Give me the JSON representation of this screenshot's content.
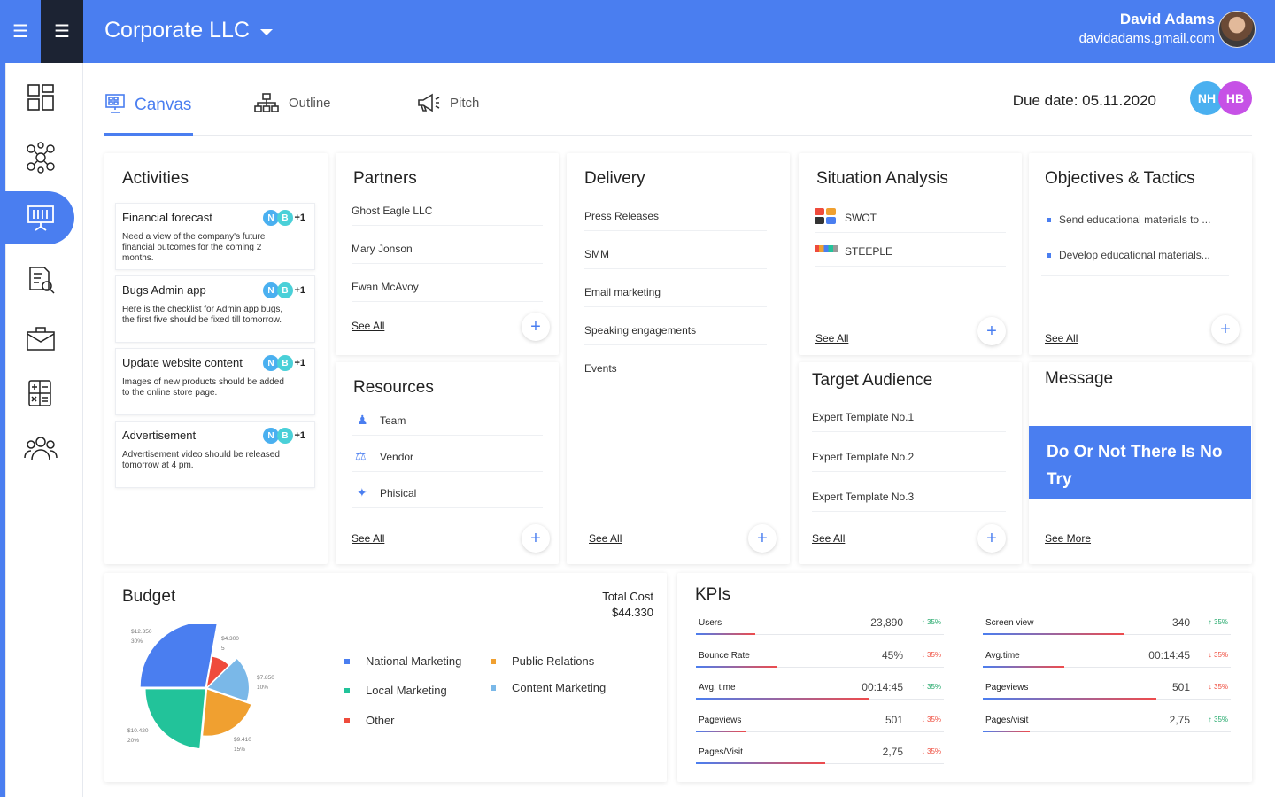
{
  "header": {
    "company": "Corporate LLC",
    "user_name": "David Adams",
    "user_email": "davidadams.gmail.com"
  },
  "sidebar": {
    "items": [
      {
        "icon": "dashboard-grid-icon"
      },
      {
        "icon": "team-network-icon"
      },
      {
        "icon": "presentation-board-icon",
        "active": true
      },
      {
        "icon": "document-money-icon"
      },
      {
        "icon": "briefcase-mail-icon"
      },
      {
        "icon": "calculator-icon"
      },
      {
        "icon": "people-group-icon"
      }
    ]
  },
  "tabs": [
    {
      "label": "Canvas",
      "icon": "presentation-icon",
      "active": true
    },
    {
      "label": "Outline",
      "icon": "hierarchy-icon"
    },
    {
      "label": "Pitch",
      "icon": "megaphone-icon"
    }
  ],
  "due_date": "Due date: 05.11.2020",
  "collaborators": [
    "NH",
    "HB"
  ],
  "activities": {
    "title": "Activities",
    "items": [
      {
        "title": "Financial forecast",
        "desc": "Need a view of the company's future financial outcomes for the coming 2 months.",
        "avatars": [
          "N",
          "B"
        ],
        "extra": "+1"
      },
      {
        "title": "Bugs Admin app",
        "desc": "Here is the checklist for Admin app bugs, the first five should be fixed till tomorrow.",
        "avatars": [
          "N",
          "B"
        ],
        "extra": "+1"
      },
      {
        "title": "Update website content",
        "desc": "Images of new products should be added to the online store page.",
        "avatars": [
          "N",
          "B"
        ],
        "extra": "+1"
      },
      {
        "title": "Advertisement",
        "desc": "Advertisement video should be released tomorrow at 4 pm.",
        "avatars": [
          "N",
          "B"
        ],
        "extra": "+1"
      }
    ]
  },
  "partners": {
    "title": "Partners",
    "items": [
      "Ghost Eagle LLC",
      "Mary Jonson",
      "Ewan McAvoy"
    ],
    "see_all": "See All"
  },
  "resources": {
    "title": "Resources",
    "items": [
      {
        "label": "Team",
        "icon": "team-icon"
      },
      {
        "label": "Vendor",
        "icon": "vendor-icon"
      },
      {
        "label": "Phisical",
        "icon": "tools-icon"
      }
    ],
    "see_all": "See All"
  },
  "delivery": {
    "title": "Delivery",
    "items": [
      "Press Releases",
      "SMM",
      "Email marketing",
      "Speaking engagements",
      "Events"
    ],
    "see_all": "See All"
  },
  "situation": {
    "title": "Situation Analysis",
    "items": [
      {
        "label": "SWOT",
        "icon": "swot-grid-icon"
      },
      {
        "label": "STEEPLE",
        "icon": "steeple-bar-icon"
      }
    ],
    "see_all": "See All"
  },
  "target": {
    "title": "Target Audience",
    "items": [
      "Expert Template No.1",
      "Expert Template No.2",
      "Expert Template No.3"
    ],
    "see_all": "See All"
  },
  "objectives": {
    "title": "Objectives & Tactics",
    "items": [
      "Send educational materials to ...",
      "Develop educational materials..."
    ],
    "see_all": "See All"
  },
  "message": {
    "title": "Message",
    "banner": "Do Or Not There Is No Try",
    "see_more": "See More"
  },
  "budget": {
    "title": "Budget",
    "total_label": "Total Cost",
    "total_value": "$44.330",
    "colors": {
      "national": "#4a7ef0",
      "public": "#f0a030",
      "local": "#22c39a",
      "content": "#7ab8e8",
      "other": "#ef4b3c"
    },
    "legend": [
      {
        "label": "National Marketing",
        "color": "#4a7ef0"
      },
      {
        "label": "Public Relations",
        "color": "#f0a030"
      },
      {
        "label": "Local Marketing",
        "color": "#22c39a"
      },
      {
        "label": "Content Marketing",
        "color": "#7ab8e8"
      },
      {
        "label": "Other",
        "color": "#ef4b3c"
      }
    ],
    "pie_labels": [
      {
        "value": "$12.350",
        "pct": "30%"
      },
      {
        "value": "$4.300",
        "pct": "5"
      },
      {
        "value": "$7.850",
        "pct": "10%"
      },
      {
        "value": "$9.410",
        "pct": "15%"
      },
      {
        "value": "$10.420",
        "pct": "20%"
      }
    ]
  },
  "chart_data": {
    "type": "pie",
    "categories": [
      "National Marketing",
      "Other",
      "Content Marketing",
      "Public Relations",
      "Local Marketing"
    ],
    "values": [
      12350,
      4300,
      7850,
      9410,
      10420
    ],
    "colors": [
      "#4a7ef0",
      "#ef4b3c",
      "#7ab8e8",
      "#f0a030",
      "#22c39a"
    ],
    "title": "Budget"
  },
  "kpis": {
    "title": "KPIs",
    "left": [
      {
        "label": "Users",
        "value": "23,890",
        "change": "35%",
        "dir": "up",
        "progress": 0.24
      },
      {
        "label": "Bounce Rate",
        "value": "45%",
        "change": "35%",
        "dir": "down",
        "progress": 0.33
      },
      {
        "label": "Avg. time",
        "value": "00:14:45",
        "change": "35%",
        "dir": "up",
        "progress": 0.7
      },
      {
        "label": "Pageviews",
        "value": "501",
        "change": "35%",
        "dir": "down",
        "progress": 0.2
      },
      {
        "label": "Pages/Visit",
        "value": "2,75",
        "change": "35%",
        "dir": "down",
        "progress": 0.52
      }
    ],
    "right": [
      {
        "label": "Screen view",
        "value": "340",
        "change": "35%",
        "dir": "up",
        "progress": 0.57
      },
      {
        "label": "Avg.time",
        "value": "00:14:45",
        "change": "35%",
        "dir": "down",
        "progress": 0.33
      },
      {
        "label": "Pageviews",
        "value": "501",
        "change": "35%",
        "dir": "down",
        "progress": 0.7
      },
      {
        "label": "Pages/visit",
        "value": "2,75",
        "change": "35%",
        "dir": "up",
        "progress": 0.19
      }
    ]
  }
}
